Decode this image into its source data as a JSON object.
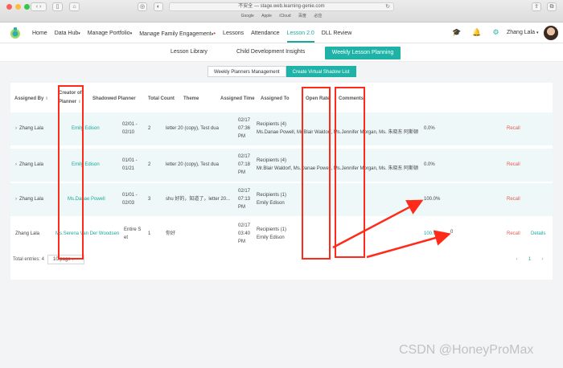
{
  "browser": {
    "address": "不安全 — stage.web.learning-genie.com",
    "bookmarks": [
      "Google",
      "Apple",
      "iCloud",
      "百度",
      "必应"
    ]
  },
  "nav": {
    "items": [
      "Home",
      "Data Hub",
      "Manage Portfolio",
      "Manage Family Engagement",
      "Lessons",
      "Attendance",
      "Lesson 2.0",
      "DLL Review"
    ],
    "user": "Zhang Lala"
  },
  "subnav": {
    "library": "Lesson Library",
    "insights": "Child Development Insights",
    "planning": "Weekly Lesson Planning"
  },
  "segments": {
    "management": "Weekly Planners Management",
    "shadow": "Create Virtual Shadow List"
  },
  "table": {
    "headers": {
      "assigned_by": "Assigned By",
      "creator_1": "Creator of",
      "creator_2": "Planner",
      "shadowed": "Shadowed Planner",
      "total": "Total Count",
      "theme": "Theme",
      "assigned_time": "Assigned Time",
      "assigned_to": "Assigned To",
      "open_rate": "Open Rate",
      "comments": "Comments"
    },
    "rows": [
      {
        "assigned_by": "Zhang Lala",
        "creator": "Emily Edison",
        "shadow_1": "02/01 -",
        "shadow_2": "02/10",
        "total": "2",
        "theme": "letter 20 (copy), Test dua",
        "time_1": "02/17",
        "time_2": "07:36",
        "time_3": "PM",
        "to_1": "Recipients (4)",
        "to_2": "Ms.Danae Powell, Mr.Blair Waldorf, Ms.Jennifer Morgan, Ms. 朱晓东 阿斯顿",
        "rate": "0.0%",
        "comments": "",
        "action_1": "Recall",
        "action_2": ""
      },
      {
        "assigned_by": "Zhang Lala",
        "creator": "Emily Edison",
        "shadow_1": "01/01 -",
        "shadow_2": "01/21",
        "total": "2",
        "theme": "letter 20 (copy), Test dua",
        "time_1": "02/17",
        "time_2": "07:18",
        "time_3": "PM",
        "to_1": "Recipients (4)",
        "to_2": "Mr.Blair Waldorf, Ms.Danae Powell, Ms.Jennifer Morgan, Ms. 朱晓东 阿斯顿",
        "rate": "0.0%",
        "comments": "",
        "action_1": "Recall",
        "action_2": ""
      },
      {
        "assigned_by": "Zhang Lala",
        "creator": "Ms.Danae Powell",
        "shadow_1": "01/01 -",
        "shadow_2": "02/03",
        "total": "3",
        "theme": "shu 好的，知道了，letter 20...",
        "time_1": "02/17",
        "time_2": "07:13",
        "time_3": "PM",
        "to_1": "Recipients (1)",
        "to_2": "Emily Edison",
        "rate": "100.0%",
        "comments": "",
        "action_1": "Recall",
        "action_2": ""
      },
      {
        "assigned_by": "Zhang Lala",
        "creator": "Ms.Serena Van Der Woodsen",
        "shadow_1": "Entire S",
        "shadow_2": "et",
        "total": "1",
        "theme": "你好",
        "time_1": "02/17",
        "time_2": "03:40",
        "time_3": "PM",
        "to_1": "Recipients (1)",
        "to_2": "Emily Edison",
        "rate": "100.0%",
        "comments": "0",
        "action_1": "Recall",
        "action_2": "Details"
      }
    ]
  },
  "footer": {
    "total": "Total entries: 4",
    "page_size": "10/page",
    "page": "1"
  },
  "watermark": "CSDN @HoneyProMax",
  "colors": {
    "accent": "#1fb3a8",
    "recall": "#e25b4c",
    "annotation": "#ff2a1a"
  }
}
